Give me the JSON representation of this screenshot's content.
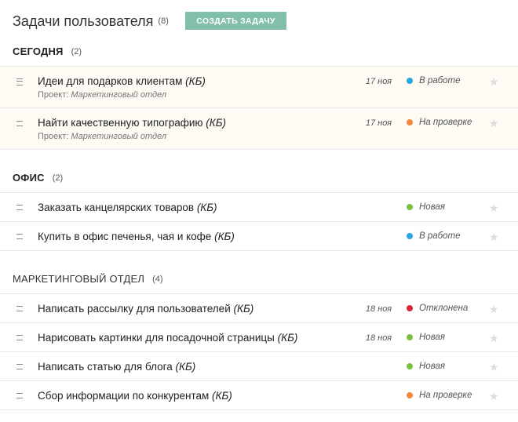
{
  "header": {
    "title": "Задачи пользователя",
    "count": "(8)",
    "create_button": "СОЗДАТЬ ЗАДАЧУ"
  },
  "sections": [
    {
      "title": "СЕГОДНЯ",
      "count": "(2)",
      "tasks": [
        {
          "title": "Идеи для подарков клиентам",
          "tag": "(КБ)",
          "project_label": "Проект:",
          "project": "Маркетинговый отдел",
          "date": "17 ноя",
          "status": "В работе",
          "status_color": "#29a8e0"
        },
        {
          "title": "Найти качественную типографию",
          "tag": "(КБ)",
          "project_label": "Проект:",
          "project": "Маркетинговый отдел",
          "date": "17 ноя",
          "status": "На проверке",
          "status_color": "#f08a3c"
        }
      ]
    },
    {
      "title": "ОФИС",
      "count": "(2)",
      "tasks": [
        {
          "title": "Заказать канцелярских товаров",
          "tag": "(КБ)",
          "date": "",
          "status": "Новая",
          "status_color": "#7cbf3f"
        },
        {
          "title": "Купить в офис печенья, чая и кофе",
          "tag": "(КБ)",
          "date": "",
          "status": "В работе",
          "status_color": "#29a8e0"
        }
      ]
    },
    {
      "title": "МАРКЕТИНГОВЫЙ ОТДЕЛ",
      "count": "(4)",
      "tasks": [
        {
          "title": "Написать рассылку для пользователей",
          "tag": "(КБ)",
          "date": "18 ноя",
          "status": "Отклонена",
          "status_color": "#d9263a"
        },
        {
          "title": "Нарисовать картинки для посадочной страницы",
          "tag": "(КБ)",
          "date": "18 ноя",
          "status": "Новая",
          "status_color": "#7cbf3f"
        },
        {
          "title": "Написать статью для блога",
          "tag": "(КБ)",
          "date": "",
          "status": "Новая",
          "status_color": "#7cbf3f"
        },
        {
          "title": "Сбор информации по конкурентам",
          "tag": "(КБ)",
          "date": "",
          "status": "На проверке",
          "status_color": "#f08a3c"
        }
      ]
    }
  ],
  "icons": {
    "drag_handle": "drag-handle-icon",
    "star": "star-icon",
    "status": "status-dot-icon"
  }
}
